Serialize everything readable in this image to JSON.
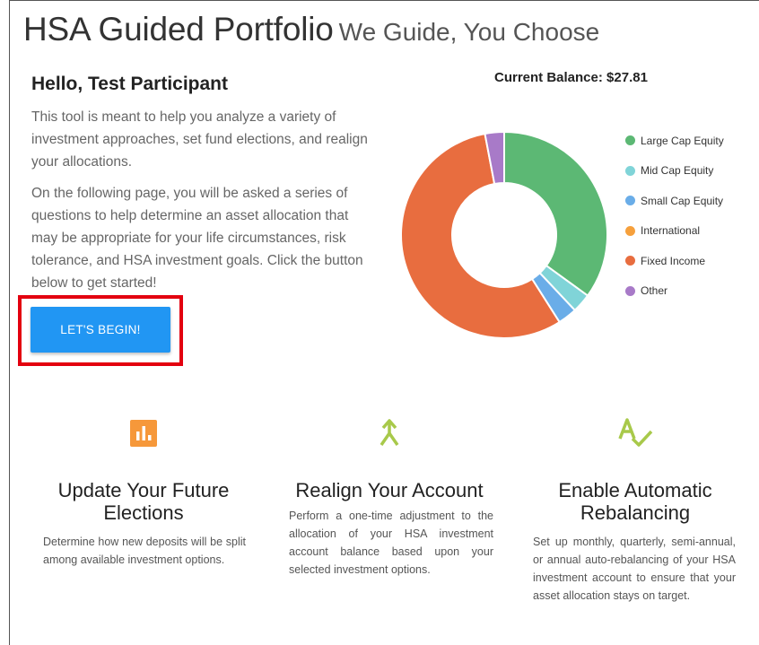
{
  "header": {
    "title": "HSA Guided Portfolio",
    "subtitle": "We Guide, You Choose"
  },
  "intro": {
    "greeting": "Hello, Test Participant",
    "paragraph1": "This tool is meant to help you analyze a variety of investment approaches, set fund elections, and realign your allocations.",
    "paragraph2": "On the following page, you will be asked a series of questions to help determine an asset allocation that may be appropriate for your life circumstances, risk tolerance, and HSA investment goals. Click the button below to get started!",
    "begin_button": "LET'S BEGIN!"
  },
  "balance": {
    "label": "Current Balance:",
    "value": "$27.81"
  },
  "chart_data": {
    "type": "pie",
    "categories": [
      "Large Cap Equity",
      "Mid Cap Equity",
      "Small Cap Equity",
      "International",
      "Fixed Income",
      "Other"
    ],
    "values": [
      35,
      3,
      3,
      0,
      56,
      3
    ],
    "colors": [
      "#5cb874",
      "#80d4d8",
      "#6aade8",
      "#f6a03c",
      "#e86d3f",
      "#a87ac8"
    ],
    "legend_position": "right"
  },
  "features": [
    {
      "icon": "bar-chart-icon",
      "title": "Update Your Future Elections",
      "description": "Determine how new deposits will be split among available investment options."
    },
    {
      "icon": "merge-arrow-icon",
      "title": "Realign Your Account",
      "description": "Perform a one-time adjustment to the allocation of your HSA investment account balance based upon your selected investment options."
    },
    {
      "icon": "spellcheck-icon",
      "title": "Enable Automatic Rebalancing",
      "description": "Set up monthly, quarterly, semi-annual, or annual auto-rebalancing of your HSA investment account to ensure that your asset allocation stays on target."
    }
  ],
  "colors": {
    "button_blue": "#2196f3",
    "highlight_red": "#e3000f",
    "icon_orange": "#f6983a",
    "icon_green": "#a8c94a"
  }
}
